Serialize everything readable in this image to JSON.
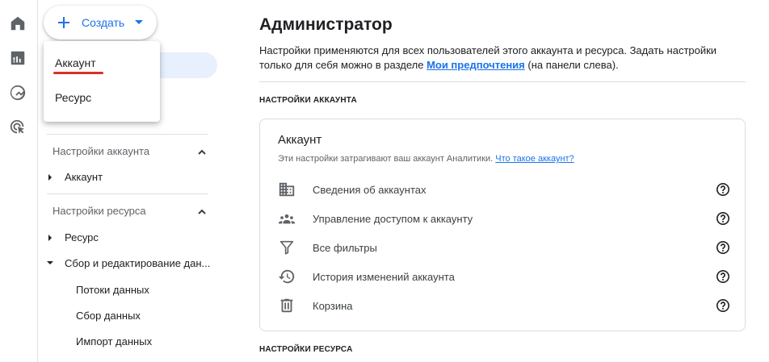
{
  "rail": {
    "icons": [
      "home-icon",
      "reports-icon",
      "explore-icon",
      "advertising-icon"
    ]
  },
  "create": {
    "label": "Создать",
    "menu": [
      {
        "label": "Аккаунт"
      },
      {
        "label": "Ресурс"
      }
    ]
  },
  "nav": {
    "account_section": "Настройки аккаунта",
    "account_items": [
      "Аккаунт"
    ],
    "property_section": "Настройки ресурса",
    "property_items": [
      "Ресурс",
      "Сбор и редактирование дан..."
    ],
    "sub_items": [
      "Потоки данных",
      "Сбор данных",
      "Импорт данных"
    ]
  },
  "main": {
    "title": "Администратор",
    "desc_before": "Настройки применяются для всех пользователей этого аккаунта и ресурса. Задать настройки только для себя можно в разделе ",
    "desc_link": "Мои предпочтения",
    "desc_after": " (на панели слева).",
    "account_caps": "НАСТРОЙКИ АККАУНТА",
    "property_caps": "НАСТРОЙКИ РЕСУРСА",
    "card": {
      "title": "Аккаунт",
      "subtitle": "Эти настройки затрагивают ваш аккаунт Аналитики. ",
      "subtitle_link": "Что такое аккаунт?",
      "rows": [
        {
          "label": "Сведения об аккаунтах",
          "icon": "building-icon"
        },
        {
          "label": "Управление доступом к аккаунту",
          "icon": "people-icon"
        },
        {
          "label": "Все фильтры",
          "icon": "filter-icon"
        },
        {
          "label": "История изменений аккаунта",
          "icon": "history-icon"
        },
        {
          "label": "Корзина",
          "icon": "trash-icon"
        }
      ]
    }
  },
  "colors": {
    "accent": "#1a73e8",
    "underline": "#d93025",
    "pill": "#e8f0fe"
  }
}
